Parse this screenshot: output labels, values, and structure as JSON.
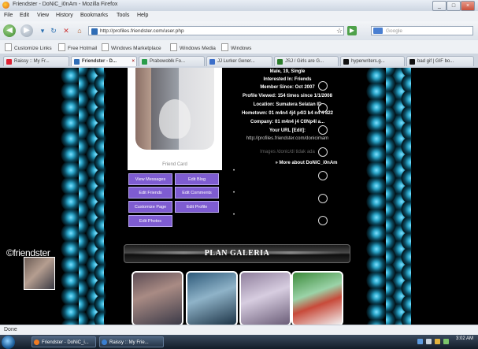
{
  "window": {
    "title": "Friendster - DoNiC_i0nAm - Mozilla Firefox"
  },
  "menus": [
    "File",
    "Edit",
    "View",
    "History",
    "Bookmarks",
    "Tools",
    "Help"
  ],
  "address": {
    "url": "http://profiles.friendster.com/user.php",
    "search_placeholder": "Google"
  },
  "bookmarks": [
    "Customize Links",
    "Free Hotmail",
    "Windows Marketplace",
    "Windows Media",
    "Windows"
  ],
  "tabs": [
    "Raissy :: My Fr...",
    "Friendster - D...",
    "Prabowoblk Fo...",
    "JJ Lurker Gener...",
    "JSJ / Girls are G...",
    "hyperwriters.g...",
    "bad gif | GIF bo..."
  ],
  "profile": {
    "info_lines": [
      "Male, 19, Single",
      "Interested In: Friends",
      "Member Since: Oct 2007",
      "Profile Viewed: 154 times since 1/1/2008",
      "Location: Sumatera Selatan ID",
      "Hometown: 01 m4n4 4j4 p4l3 b4 n4 4 822",
      "Company: 01 m4n4 j4 C0Np4l a...",
      "Your URL [Edit]:",
      "http://profiles.friendster.com/donicimam",
      "Images /donic/di tidak ada",
      "» More about DoNiC_i0nAm"
    ],
    "photo_caption": "Friend Card",
    "actions": [
      "View Messages",
      "Edit Blog",
      "Edit Friends",
      "Edit Comments",
      "Customize Page",
      "Edit Profile",
      "Edit Photos"
    ]
  },
  "logo_text": "©friendster",
  "banner_text": "PLAN GALERIA",
  "status": "Done",
  "taskbar": {
    "items": [
      "Friendster - DoNiC_i...",
      "Raissy :: My Frie..."
    ],
    "clock": "3:02 AM"
  },
  "colors": {
    "accent_purple": "#7e5cd1",
    "stripe_teal": "#2ca6c9",
    "page_bg": "#000000"
  }
}
